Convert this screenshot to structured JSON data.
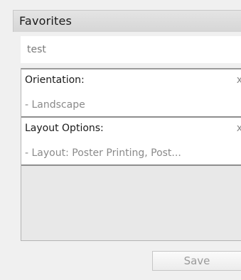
{
  "header": {
    "title": "Favorites"
  },
  "name_field": {
    "value": "test"
  },
  "groups": [
    {
      "title": "Orientation:",
      "close_glyph": "x",
      "value": "- Landscape"
    },
    {
      "title": "Layout Options:",
      "close_glyph": "x",
      "value": "- Layout: Poster Printing, Post..."
    }
  ],
  "footer": {
    "save_label": "Save"
  }
}
